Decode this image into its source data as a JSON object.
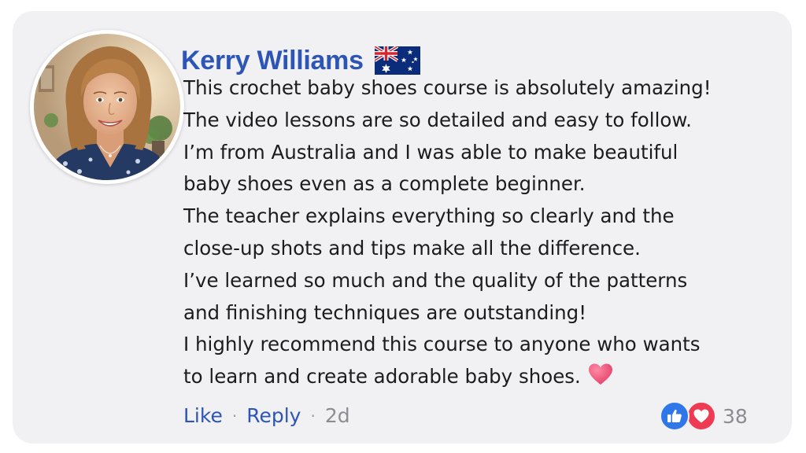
{
  "comment": {
    "author": "Kerry Williams",
    "country_flag": "australia-flag-icon",
    "lines": [
      "This crochet baby shoes course is absolutely amazing!",
      "The video lessons are so detailed and easy to follow.",
      "I’m from Australia and I was able to make beautiful",
      "baby shoes even as a complete beginner.",
      "The teacher explains everything so clearly and the",
      "close-up shots and tips make all the difference.",
      "I’ve learned so much and the quality of the patterns",
      "and finishing techniques are outstanding!",
      "I highly recommend this course to anyone who wants",
      "to learn and create adorable baby shoes."
    ],
    "end_emoji": "heart-icon"
  },
  "actions": {
    "like_label": "Like",
    "separator": "·",
    "reply_label": "Reply",
    "timestamp": "2d"
  },
  "reactions": {
    "types": [
      "like-icon",
      "love-icon"
    ],
    "count": "38"
  },
  "colors": {
    "card_background": "#f1f1f4",
    "author_name": "#2d55b6",
    "link": "#2d55b6",
    "body_text": "#1c1c1c",
    "muted_text": "#8c8c92",
    "like_blue": "#2f76e8",
    "love_red": "#ee3b53"
  }
}
